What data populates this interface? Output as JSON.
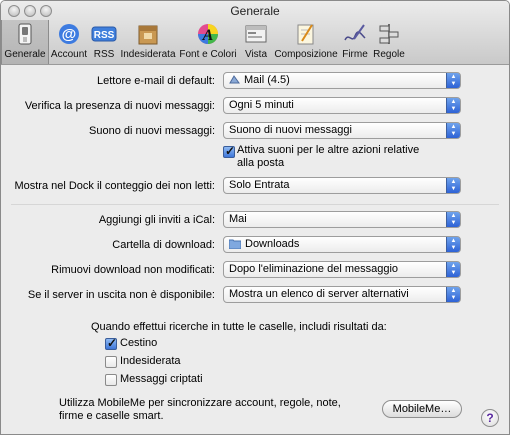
{
  "window": {
    "title": "Generale"
  },
  "toolbar": {
    "items": [
      {
        "label": "Generale",
        "icon": "switch-icon",
        "selected": true
      },
      {
        "label": "Account",
        "icon": "at-sign-icon"
      },
      {
        "label": "RSS",
        "icon": "rss-icon",
        "badge": "RSS"
      },
      {
        "label": "Indesiderata",
        "icon": "junk-mail-icon"
      },
      {
        "label": "Font e Colori",
        "icon": "font-colors-icon",
        "glyph": "A"
      },
      {
        "label": "Vista",
        "icon": "view-icon"
      },
      {
        "label": "Composizione",
        "icon": "compose-icon"
      },
      {
        "label": "Firme",
        "icon": "signature-icon"
      },
      {
        "label": "Regole",
        "icon": "rules-icon"
      }
    ]
  },
  "settings": {
    "default_reader": {
      "label": "Lettore e-mail di default:",
      "value": "Mail (4.5)"
    },
    "check_new": {
      "label": "Verifica la presenza di nuovi messaggi:",
      "value": "Ogni 5 minuti"
    },
    "new_sound": {
      "label": "Suono di nuovi messaggi:",
      "value": "Suono di nuovi messaggi"
    },
    "play_sounds": {
      "label_line1": "Attiva suoni per le altre azioni relative",
      "label_line2": "alla posta",
      "checked": true
    },
    "dock_unread": {
      "label": "Mostra nel Dock il conteggio dei non letti:",
      "value": "Solo Entrata"
    },
    "add_invites": {
      "label": "Aggiungi gli inviti a iCal:",
      "value": "Mai"
    },
    "download_folder": {
      "label": "Cartella di download:",
      "value": "Downloads"
    },
    "remove_downloads": {
      "label": "Rimuovi download non modificati:",
      "value": "Dopo l'eliminazione del messaggio"
    },
    "server_unavailable": {
      "label": "Se il server in uscita non è disponibile:",
      "value": "Mostra un elenco di server alternativi"
    }
  },
  "search": {
    "heading": "Quando effettui ricerche in tutte le caselle, includi risultati da:",
    "options": [
      {
        "label": "Cestino",
        "checked": true
      },
      {
        "label": "Indesiderata",
        "checked": false
      },
      {
        "label": "Messaggi criptati",
        "checked": false
      }
    ]
  },
  "mobileme": {
    "text_line1": "Utilizza MobileMe per sincronizzare account, regole, note,",
    "text_line2": "firme e caselle smart.",
    "button": "MobileMe…"
  },
  "help": {
    "glyph": "?"
  }
}
